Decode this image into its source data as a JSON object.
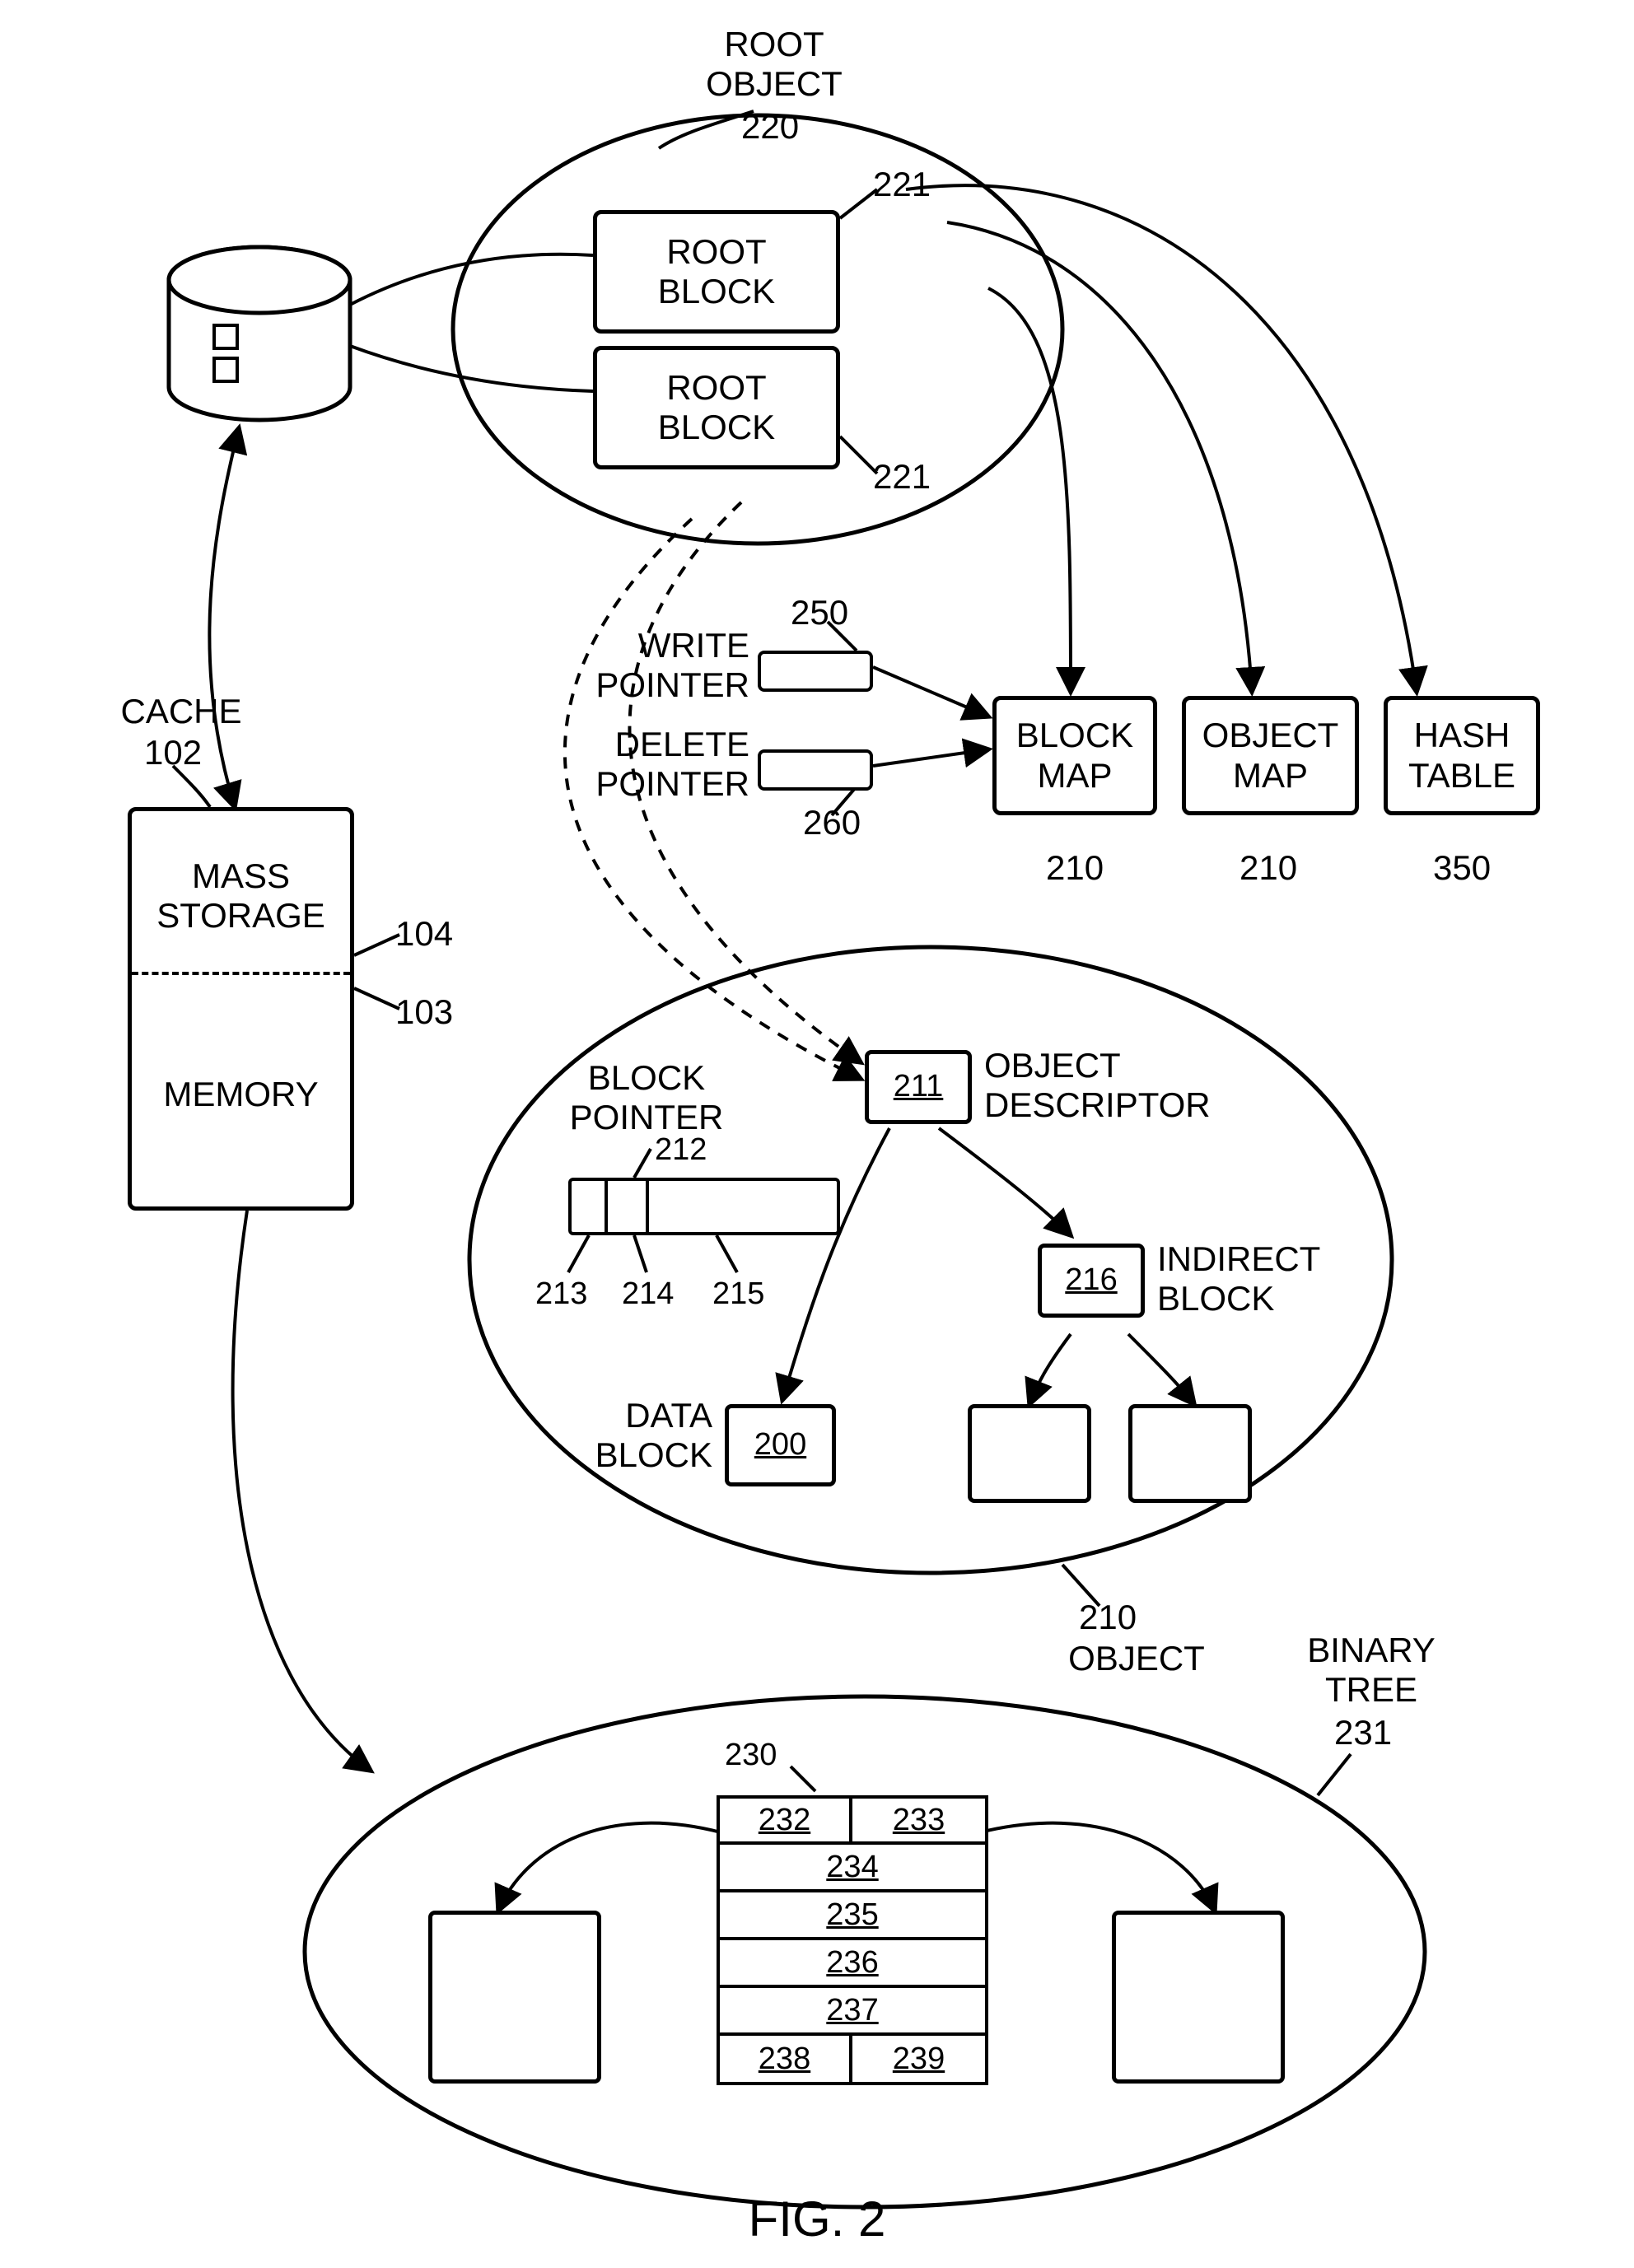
{
  "figure_caption": "FIG. 2",
  "cache": {
    "title_label": "CACHE",
    "ref": "102"
  },
  "mass_storage": {
    "label": "MASS\nSTORAGE",
    "ref": "104"
  },
  "memory": {
    "label": "MEMORY",
    "ref": "103"
  },
  "root_object": {
    "label": "ROOT\nOBJECT",
    "ref": "220"
  },
  "root_block_a": {
    "label": "ROOT\nBLOCK",
    "ref": "221"
  },
  "root_block_b": {
    "label": "ROOT\nBLOCK",
    "ref": "221"
  },
  "write_pointer": {
    "label": "WRITE\nPOINTER",
    "ref": "250"
  },
  "delete_pointer": {
    "label": "DELETE\nPOINTER",
    "ref": "260"
  },
  "block_map": {
    "label": "BLOCK\nMAP",
    "ref": "210"
  },
  "object_map": {
    "label": "OBJECT\nMAP",
    "ref": "210"
  },
  "hash_table": {
    "label": "HASH\nTABLE",
    "ref": "350"
  },
  "object": {
    "label": "OBJECT",
    "ref": "210"
  },
  "block_pointer": {
    "label": "BLOCK\nPOINTER",
    "ref": "212",
    "seg_a": "213",
    "seg_b": "214",
    "seg_c": "215"
  },
  "object_descriptor": {
    "label": "OBJECT\nDESCRIPTOR",
    "num": "211"
  },
  "indirect_block": {
    "label": "INDIRECT\nBLOCK",
    "num": "216"
  },
  "data_block": {
    "label": "DATA\nBLOCK",
    "num": "200"
  },
  "binary_tree": {
    "label": "BINARY\nTREE",
    "ref": "231"
  },
  "tree_node": {
    "ref": "230",
    "row1_left": "232",
    "row1_right": "233",
    "row2": "234",
    "row3": "235",
    "row4": "236",
    "row5": "237",
    "row6_left": "238",
    "row6_right": "239"
  }
}
